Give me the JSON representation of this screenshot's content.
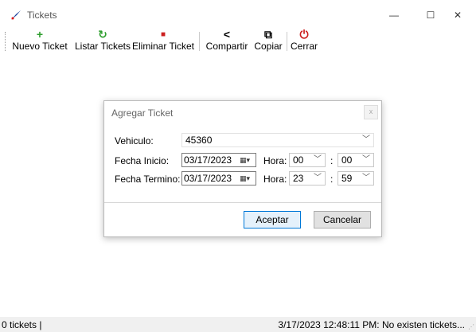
{
  "window": {
    "title": "Tickets",
    "controls": {
      "minimize": "—",
      "maximize": "☐",
      "close": "✕"
    }
  },
  "toolbar": {
    "nuevo": {
      "icon": "plus-icon",
      "glyph": "+",
      "label": "Nuevo Ticket",
      "color": "#2e9e2e"
    },
    "listar": {
      "icon": "refresh-icon",
      "glyph": "↻",
      "label": "Listar Tickets",
      "color": "#2e9e2e"
    },
    "eliminar": {
      "icon": "trash-icon",
      "glyph": "■",
      "label": "Eliminar Ticket",
      "color": "#cc1f1f"
    },
    "compartir": {
      "icon": "share-icon",
      "glyph": "<",
      "label": "Compartir"
    },
    "copiar": {
      "icon": "copy-icon",
      "glyph": "⧉",
      "label": "Copiar"
    },
    "cerrar": {
      "icon": "power-icon",
      "glyph": "⏻",
      "label": "Cerrar",
      "color": "#cc1f1f"
    }
  },
  "dialog": {
    "title": "Agregar Ticket",
    "close_glyph": "x",
    "vehiculo": {
      "label": "Vehiculo:",
      "value": "45360"
    },
    "fecha_inicio": {
      "label": "Fecha Inicio:",
      "date": "03/17/2023",
      "hora_label": "Hora:",
      "hour": "00",
      "minute": "00"
    },
    "fecha_termino": {
      "label": "Fecha Termino:",
      "date": "03/17/2023",
      "hora_label": "Hora:",
      "hour": "23",
      "minute": "59"
    },
    "colon": ":",
    "aceptar": "Aceptar",
    "cancelar": "Cancelar"
  },
  "statusbar": {
    "left": "0 tickets  |",
    "right": "3/17/2023 12:48:11 PM: No existen tickets..."
  }
}
